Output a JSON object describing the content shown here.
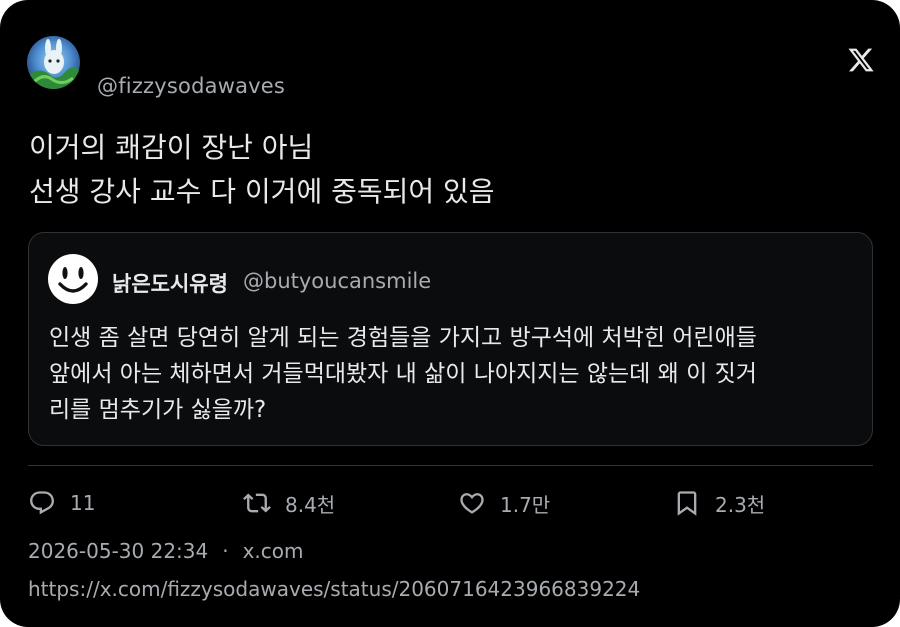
{
  "author": {
    "handle": "@fizzysodawaves"
  },
  "tweet": {
    "lines": [
      "이거의 쾌감이 장난 아님",
      "선생 강사 교수 다 이거에 중독되어 있음"
    ]
  },
  "quoted": {
    "name": "낡은도시유령",
    "handle": "@butyoucansmile",
    "lines": [
      "인생 좀 살면 당연히 알게 되는 경험들을 가지고 방구석에 처박힌 어린애들",
      "앞에서 아는 체하면서 거들먹대봤자 내 삶이 나아지지는 않는데 왜 이 짓거",
      "리를 멈추기가 싫을까?"
    ]
  },
  "stats": {
    "replies": "11",
    "retweets": "8.4천",
    "likes": "1.7만",
    "bookmarks": "2.3천"
  },
  "meta": {
    "timestamp": "2026-05-30 22:34",
    "separator": "·",
    "source": "x.com",
    "url": "https://x.com/fizzysodawaves/status/2060716423966839224"
  },
  "icons": {
    "brand": "x-logo-icon",
    "reply": "reply-icon",
    "retweet": "retweet-icon",
    "like": "heart-icon",
    "bookmark": "bookmark-icon"
  },
  "colors": {
    "background": "#000000",
    "text": "#e7e9ea",
    "muted": "#a8acb1",
    "border": "#2f3336"
  }
}
